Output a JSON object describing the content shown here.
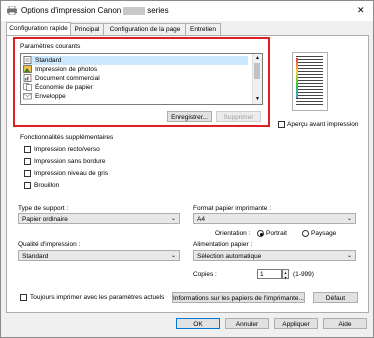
{
  "window": {
    "title_prefix": "Options d'impression Canon",
    "title_suffix": "series",
    "close_glyph": "✕"
  },
  "tabs": [
    {
      "label": "Configuration rapide",
      "active": true
    },
    {
      "label": "Principal",
      "active": false
    },
    {
      "label": "Configuration de la page",
      "active": false
    },
    {
      "label": "Entretien",
      "active": false
    }
  ],
  "common_settings": {
    "label": "Paramètres courants",
    "items": [
      {
        "label": "Standard",
        "icon": "standard-doc-icon",
        "selected": true
      },
      {
        "label": "Impression de photos",
        "icon": "photo-icon",
        "selected": false
      },
      {
        "label": "Document commercial",
        "icon": "business-doc-icon",
        "selected": false
      },
      {
        "label": "Économie de papier",
        "icon": "paper-saving-icon",
        "selected": false
      },
      {
        "label": "Enveloppe",
        "icon": "envelope-icon",
        "selected": false
      }
    ],
    "save_button": "Enregistrer...",
    "delete_button": "Supprimer"
  },
  "preview": {
    "always_print_preview": "Aperçu avant impression"
  },
  "additional_features": {
    "label": "Fonctionnalités supplémentaires",
    "options": [
      {
        "label": "Impression recto/verso",
        "checked": false
      },
      {
        "label": "Impression sans bordure",
        "checked": false
      },
      {
        "label": "Impression niveau de gris",
        "checked": false
      },
      {
        "label": "Brouillon",
        "checked": false
      }
    ]
  },
  "media_type": {
    "label": "Type de support :",
    "value": "Papier ordinaire"
  },
  "printer_paper_size": {
    "label": "Format papier imprimante :",
    "value": "A4"
  },
  "orientation": {
    "label": "Orientation :",
    "portrait": "Portrait",
    "landscape": "Paysage",
    "selected": "Portrait"
  },
  "print_quality": {
    "label": "Qualité d'impression :",
    "value": "Standard"
  },
  "paper_source": {
    "label": "Alimentation papier :",
    "value": "Sélection automatique"
  },
  "copies": {
    "label": "Copies :",
    "value": "1",
    "range": "(1-999)"
  },
  "bottom": {
    "always_print_current": "Toujours imprimer avec les paramètres actuels",
    "paper_info_button": "Informations sur les papiers de l'imprimante...",
    "default_button": "Défaut"
  },
  "dialog_buttons": {
    "ok": "OK",
    "cancel": "Annuler",
    "apply": "Appliquer",
    "help": "Aide"
  }
}
